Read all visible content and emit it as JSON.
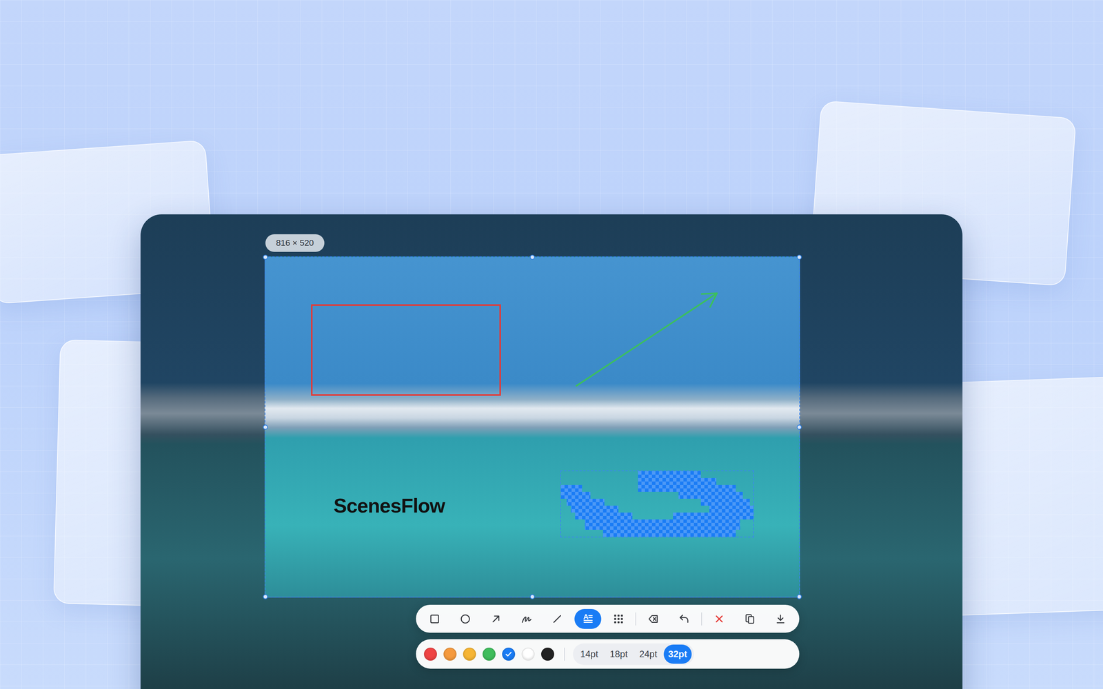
{
  "selection": {
    "size_label": "816 × 520"
  },
  "annotations": [
    {
      "kind": "rectangle",
      "color": "#e53935"
    },
    {
      "kind": "arrow",
      "color": "#3cbf5e"
    },
    {
      "kind": "text",
      "text": "ScenesFlow",
      "color": "#111111"
    },
    {
      "kind": "mosaic",
      "color": "#1a7cf5"
    }
  ],
  "tools": [
    {
      "kind": "rectangle",
      "selected": false
    },
    {
      "kind": "ellipse",
      "selected": false
    },
    {
      "kind": "arrow",
      "selected": false
    },
    {
      "kind": "pen",
      "selected": false
    },
    {
      "kind": "line",
      "selected": false
    },
    {
      "kind": "text",
      "selected": true
    },
    {
      "kind": "mosaic",
      "selected": false
    }
  ],
  "colors": [
    {
      "color": "#ef4444",
      "selected": false
    },
    {
      "color": "#f59a3e",
      "selected": false
    },
    {
      "color": "#f6b534",
      "selected": false
    },
    {
      "color": "#3fbd5c",
      "selected": false
    },
    {
      "color": "#1a7cf5",
      "selected": true
    },
    {
      "color": "#ffffff",
      "selected": false
    },
    {
      "color": "#222222",
      "selected": false
    }
  ],
  "font_sizes": [
    {
      "label": "14pt",
      "selected": false
    },
    {
      "label": "18pt",
      "selected": false
    },
    {
      "label": "24pt",
      "selected": false
    },
    {
      "label": "32pt",
      "selected": true
    }
  ]
}
